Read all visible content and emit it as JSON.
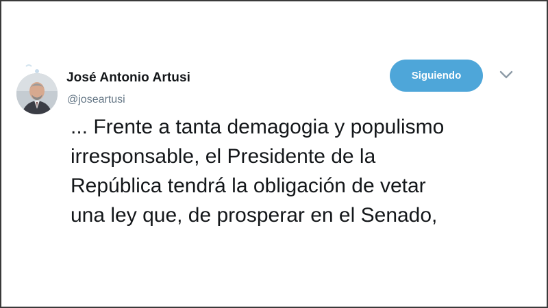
{
  "tweet": {
    "author": {
      "display_name": "José Antonio Artusi",
      "handle": "@joseartusi",
      "avatar_icon": "profile-photo-icon"
    },
    "follow_button_label": "Siguiendo",
    "menu_icon": "chevron-down-icon",
    "text_lines": [
      "... Frente a tanta demagogia y populismo",
      "irresponsable, el Presidente de la",
      "República tendrá la obligación de vetar",
      "una ley que, de prosperar en el Senado,"
    ]
  },
  "colors": {
    "follow_button": "#4ea6d9",
    "name_text": "#14171a",
    "handle_text": "#657786"
  }
}
